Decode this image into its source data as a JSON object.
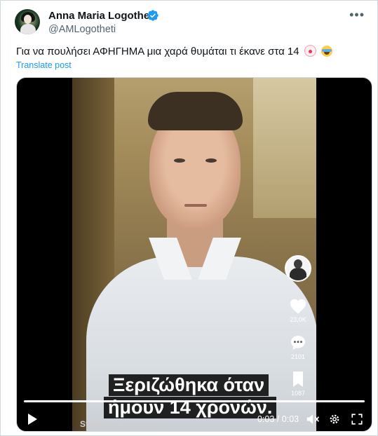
{
  "author": {
    "name": "Anna Maria Logotheti",
    "handle": "@AMLogotheti",
    "verified_icon": "verified-badge-icon"
  },
  "tweet": {
    "text": "Για να πουλήσει ΑΦΗΓΗΜΑ μια χαρά θυμάται τι έκανε στα 14",
    "emojis": [
      "clown-face-icon",
      "tears-of-joy-icon"
    ],
    "translate_label": "Translate post"
  },
  "video": {
    "caption_line1": "Ξεριζώθηκα όταν",
    "caption_line2": "ήμουν 14 χρονών.",
    "watermark": "Stefanos Kasselakis",
    "likes": "23,0K",
    "comments": "2101",
    "saves": "1087",
    "time_current": "0:03",
    "time_total": "0:03",
    "progress": 1.0
  },
  "colors": {
    "accent": "#1d9bf0",
    "text": "#0f1419",
    "secondary": "#536471"
  }
}
